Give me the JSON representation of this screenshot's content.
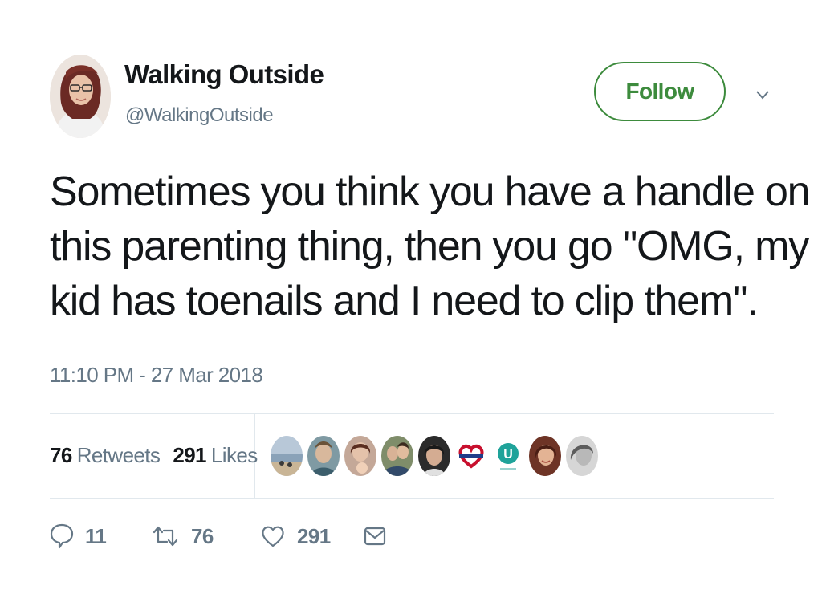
{
  "author": {
    "display_name": "Walking Outside",
    "handle": "@WalkingOutside",
    "avatar_icon": "user-avatar-photo"
  },
  "follow_button": {
    "label": "Follow",
    "color": "#3d8b3d"
  },
  "menu_icon": "chevron-down-icon",
  "tweet": {
    "lines": [
      "Sometimes you think you have a handle on",
      "this parenting thing, then you go \"OMG, my",
      "kid has toenails and I need to clip them\"."
    ],
    "timestamp": "11:10 PM - 27 Mar 2018"
  },
  "stats": {
    "retweets_count": "76",
    "retweets_label": "Retweets",
    "likes_count": "291",
    "likes_label": "Likes"
  },
  "liked_by": [
    {
      "name": "liker-avatar-1",
      "bg": "#a9b8c8",
      "fg": "#5b6b7a"
    },
    {
      "name": "liker-avatar-2",
      "bg": "#8aa0a8",
      "fg": "#c8b39a"
    },
    {
      "name": "liker-avatar-3",
      "bg": "#b58a7c",
      "fg": "#e2c0a8"
    },
    {
      "name": "liker-avatar-4",
      "bg": "#6f7b5e",
      "fg": "#d6b69a"
    },
    {
      "name": "liker-avatar-5",
      "bg": "#2e2e2e",
      "fg": "#cfa98f"
    },
    {
      "name": "liker-avatar-6",
      "bg": "#ffffff",
      "fg": "#c8102e"
    },
    {
      "name": "liker-avatar-7",
      "bg": "#ffffff",
      "fg": "#1fa39a"
    },
    {
      "name": "liker-avatar-8",
      "bg": "#7a3b2b",
      "fg": "#e6b596"
    },
    {
      "name": "liker-avatar-9",
      "bg": "#d0d0d0",
      "fg": "#6a6a6a"
    }
  ],
  "liker_7_letter": "U",
  "actions": {
    "reply": {
      "icon": "reply-icon",
      "count": "11"
    },
    "retweet": {
      "icon": "retweet-icon",
      "count": "76"
    },
    "like": {
      "icon": "heart-icon",
      "count": "291"
    },
    "message": {
      "icon": "envelope-icon"
    }
  },
  "colors": {
    "text": "#14171a",
    "secondary": "#657786",
    "divider": "#e1e8ed"
  }
}
